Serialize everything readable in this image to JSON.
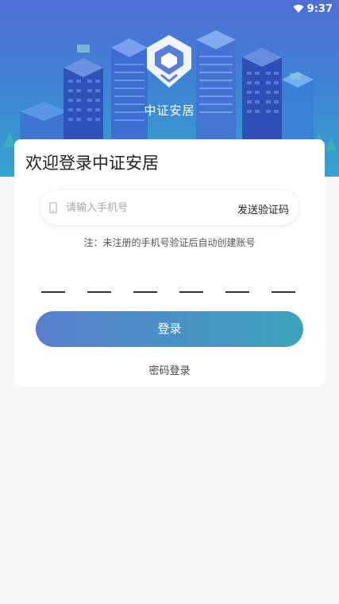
{
  "status_bar": {
    "time": "9:37"
  },
  "brand": {
    "name": "中证安居"
  },
  "login": {
    "title": "欢迎登录中证安居",
    "phone_placeholder": "请输入手机号",
    "send_code_label": "发送验证码",
    "note": "注：未注册的手机号验证后自动创建账号",
    "code_length": 6,
    "login_button_label": "登录",
    "password_login_label": "密码登录"
  },
  "colors": {
    "hero_top": "#4f6fd6",
    "hero_bottom": "#35a3cf",
    "button_start": "#5a7fcd",
    "button_end": "#3ba3bd"
  },
  "icons": {
    "status": [
      "wifi-icon"
    ],
    "logo": "house-shield-logo-icon",
    "phone": "phone-icon"
  }
}
